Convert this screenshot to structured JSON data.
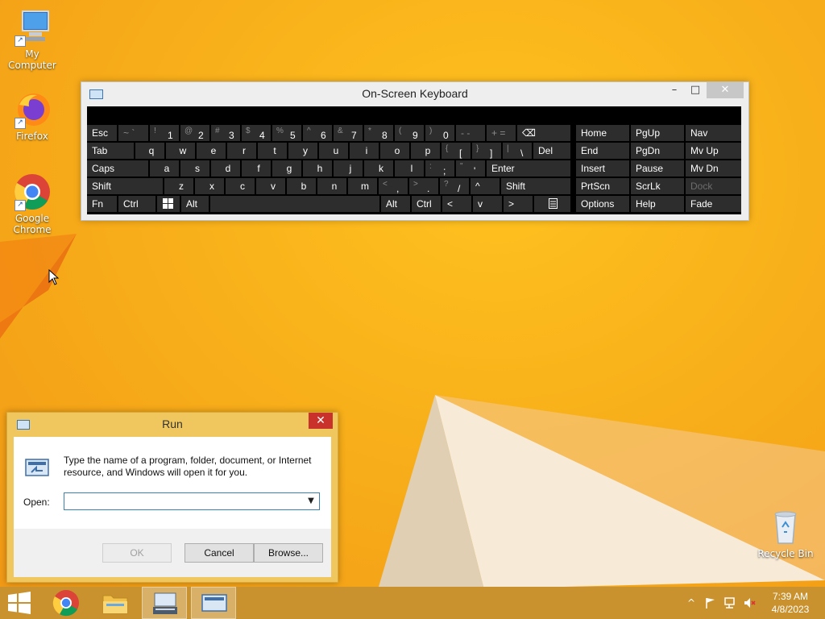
{
  "desktop": {
    "icons": [
      {
        "label": "My Computer"
      },
      {
        "label": "Firefox"
      },
      {
        "label": "Google Chrome"
      },
      {
        "label": "Recycle Bin"
      }
    ]
  },
  "osk": {
    "title": "On-Screen Keyboard",
    "controls": {
      "minimize": "–",
      "maximize": "□",
      "close": "✕"
    },
    "keys": {
      "esc": "Esc",
      "tilde_sub": "~ `",
      "k1_sub": "!",
      "k1": "1",
      "k2_sub": "@",
      "k2": "2",
      "k3_sub": "#",
      "k3": "3",
      "k4_sub": "$",
      "k4": "4",
      "k5_sub": "%",
      "k5": "5",
      "k6_sub": "^",
      "k6": "6",
      "k7_sub": "&",
      "k7": "7",
      "k8_sub": "*",
      "k8": "8",
      "k9_sub": "(",
      "k9": "9",
      "k0_sub": ")",
      "k0": "0",
      "minus": "- -",
      "plus": "+ =",
      "backspace": "⌫",
      "tab": "Tab",
      "q": "q",
      "w": "w",
      "e": "e",
      "r": "r",
      "t": "t",
      "y": "y",
      "u": "u",
      "i": "i",
      "o": "o",
      "p": "p",
      "lbracket_sub": "{",
      "lbracket": "[",
      "rbracket_sub": "}",
      "rbracket": "]",
      "bslash_sub": "|",
      "bslash": "\\",
      "del": "Del",
      "caps": "Caps",
      "a": "a",
      "s": "s",
      "d": "d",
      "f": "f",
      "g": "g",
      "h": "h",
      "j": "j",
      "k": "k",
      "l": "l",
      "semicolon_sub": ":",
      "semicolon": ";",
      "quote_sub": "\"",
      "quote": "'",
      "enter": "Enter",
      "shift": "Shift",
      "z": "z",
      "x": "x",
      "c": "c",
      "v": "v",
      "b": "b",
      "n": "n",
      "m": "m",
      "comma_sub": "<",
      "comma": ",",
      "period_sub": ">",
      "period": ".",
      "slash_sub": "?",
      "slash": "/",
      "up": "^",
      "rshift": "Shift",
      "fn": "Fn",
      "ctrl": "Ctrl",
      "alt": "Alt",
      "ralt": "Alt",
      "rctrl": "Ctrl",
      "left": "<",
      "down": "v",
      "right": ">",
      "home": "Home",
      "pgup": "PgUp",
      "nav": "Nav",
      "end": "End",
      "pgdn": "PgDn",
      "mvup": "Mv Up",
      "insert": "Insert",
      "pause": "Pause",
      "mvdn": "Mv Dn",
      "prtscn": "PrtScn",
      "scrlk": "ScrLk",
      "dock": "Dock",
      "options": "Options",
      "help": "Help",
      "fade": "Fade"
    }
  },
  "run": {
    "title": "Run",
    "close": "✕",
    "description": "Type the name of a program, folder, document, or Internet resource, and Windows will open it for you.",
    "open_label": "Open:",
    "open_value": "",
    "ok": "OK",
    "cancel": "Cancel",
    "browse": "Browse..."
  },
  "taskbar": {
    "clock_time": "7:39 AM",
    "clock_date": "4/8/2023",
    "tray_chevron": "^"
  }
}
